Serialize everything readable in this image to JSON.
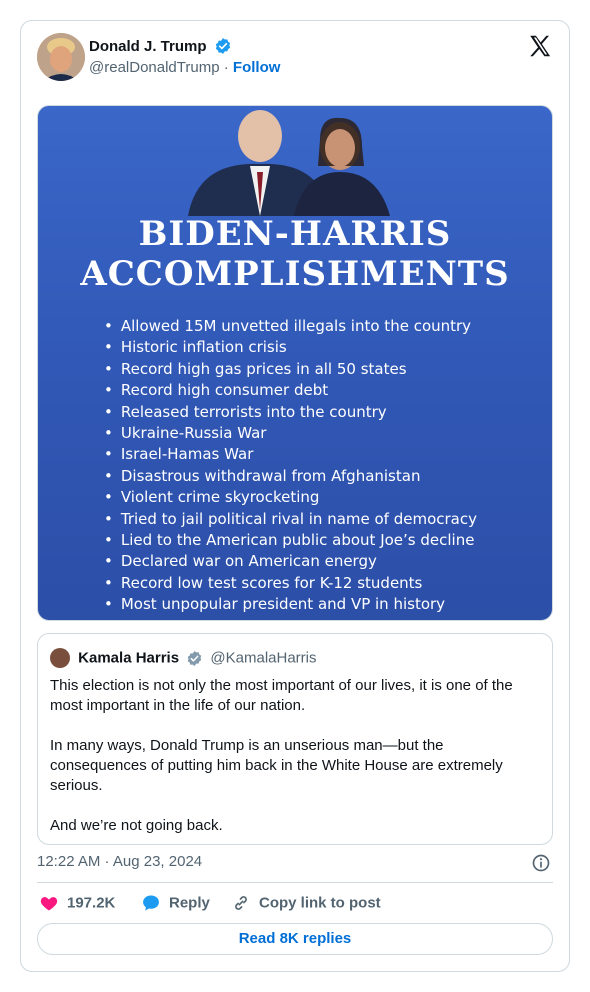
{
  "post": {
    "author_name": "Donald J. Trump",
    "author_handle": "@realDonaldTrump",
    "separator": "·",
    "follow_label": "Follow"
  },
  "media": {
    "title_line1": "BIDEN-HARRIS",
    "title_line2": "ACCOMPLISHMENTS",
    "items": [
      "Allowed 15M unvetted illegals into the country",
      "Historic inflation crisis",
      "Record high gas prices in all 50 states",
      "Record high consumer debt",
      "Released terrorists into the country",
      "Ukraine-Russia War",
      "Israel-Hamas War",
      "Disastrous withdrawal from Afghanistan",
      "Violent crime skyrocketing",
      "Tried to jail political rival in name of democracy",
      "Lied to the American public about Joe’s decline",
      "Declared war on American energy",
      "Record low test scores for K-12 students",
      "Most unpopular president and VP in history"
    ]
  },
  "quote": {
    "author_name": "Kamala Harris",
    "author_handle": "@KamalaHarris",
    "paragraphs": [
      "This election is not only the most important of our lives, it is one of the most important in the life of our nation.",
      "In many ways, Donald Trump is an unserious man—but the consequences of putting him back in the White House are extremely serious.",
      "And we’re not going back."
    ]
  },
  "timestamp": "12:22 AM · Aug 23, 2024",
  "actions": {
    "like_count": "197.2K",
    "reply_label": "Reply",
    "copy_label": "Copy link to post"
  },
  "read_replies_label": "Read 8K replies",
  "colors": {
    "accent": "#006fd6",
    "verified": "#1d9bf0",
    "like": "#f91880",
    "media_blue": "#3158b6"
  }
}
